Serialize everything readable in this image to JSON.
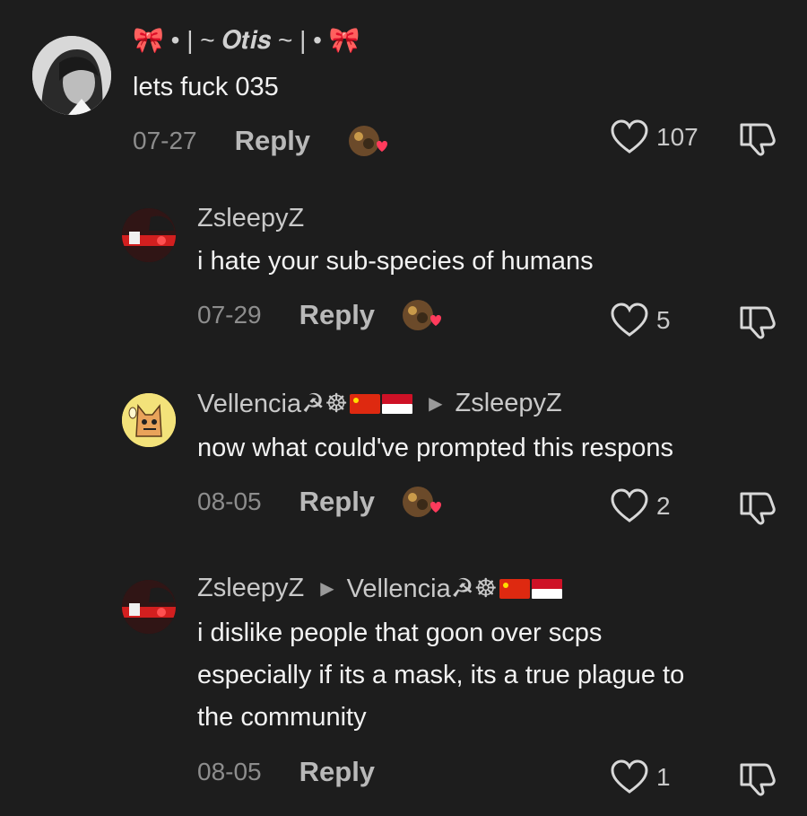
{
  "comments": [
    {
      "username": "🎀 • | ~ 𝑶𝒕𝒊𝒔 ~ | • 🎀",
      "text_lines": [
        "lets fuck 035"
      ],
      "date": "07-27",
      "reply_label": "Reply",
      "likes": "107"
    },
    {
      "username": "ZsleepyZ",
      "text_lines": [
        "i hate your sub-species of humans"
      ],
      "date": "07-29",
      "reply_label": "Reply",
      "likes": "5"
    },
    {
      "username": "Vellencia☭☸",
      "reply_to": "ZsleepyZ",
      "text_lines": [
        "now what could've prompted this respons"
      ],
      "date": "08-05",
      "reply_label": "Reply",
      "likes": "2"
    },
    {
      "username": "ZsleepyZ",
      "reply_to": "Vellencia☭☸",
      "text_lines": [
        "i dislike people that goon over scps",
        "especially if its a mask, its a true plague to",
        "the community"
      ],
      "date": "08-05",
      "reply_label": "Reply",
      "likes": "1"
    }
  ],
  "colors": {
    "background": "#1d1d1d",
    "heart": "#ff3b5c"
  },
  "icons": [
    "heart-outline-icon",
    "dislike-icon",
    "creator-liked-heart-icon",
    "reply-arrow-icon"
  ]
}
